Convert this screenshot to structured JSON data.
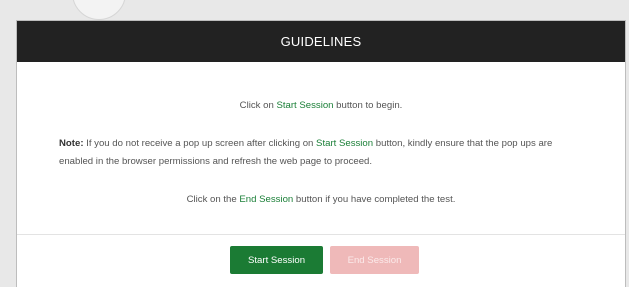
{
  "modal": {
    "title": "GUIDELINES",
    "line1": {
      "before": "Click on ",
      "highlight": "Start Session",
      "after": " button to begin."
    },
    "note": {
      "label": "Note:",
      "before": " If you do not receive a pop up screen after clicking on ",
      "highlight": "Start Session",
      "after": " button, kindly ensure that the pop ups are enabled in the browser permissions and refresh the web page to proceed."
    },
    "line3": {
      "before": "Click on the ",
      "highlight": "End Session",
      "after": " button if you have completed the test."
    },
    "buttons": {
      "start_label": "Start Session",
      "end_label": "End Session"
    }
  },
  "colors": {
    "header_bg": "#222222",
    "highlight": "#1a7f37",
    "start_button": "#1b7b34",
    "end_button_disabled": "#efb9b9"
  }
}
